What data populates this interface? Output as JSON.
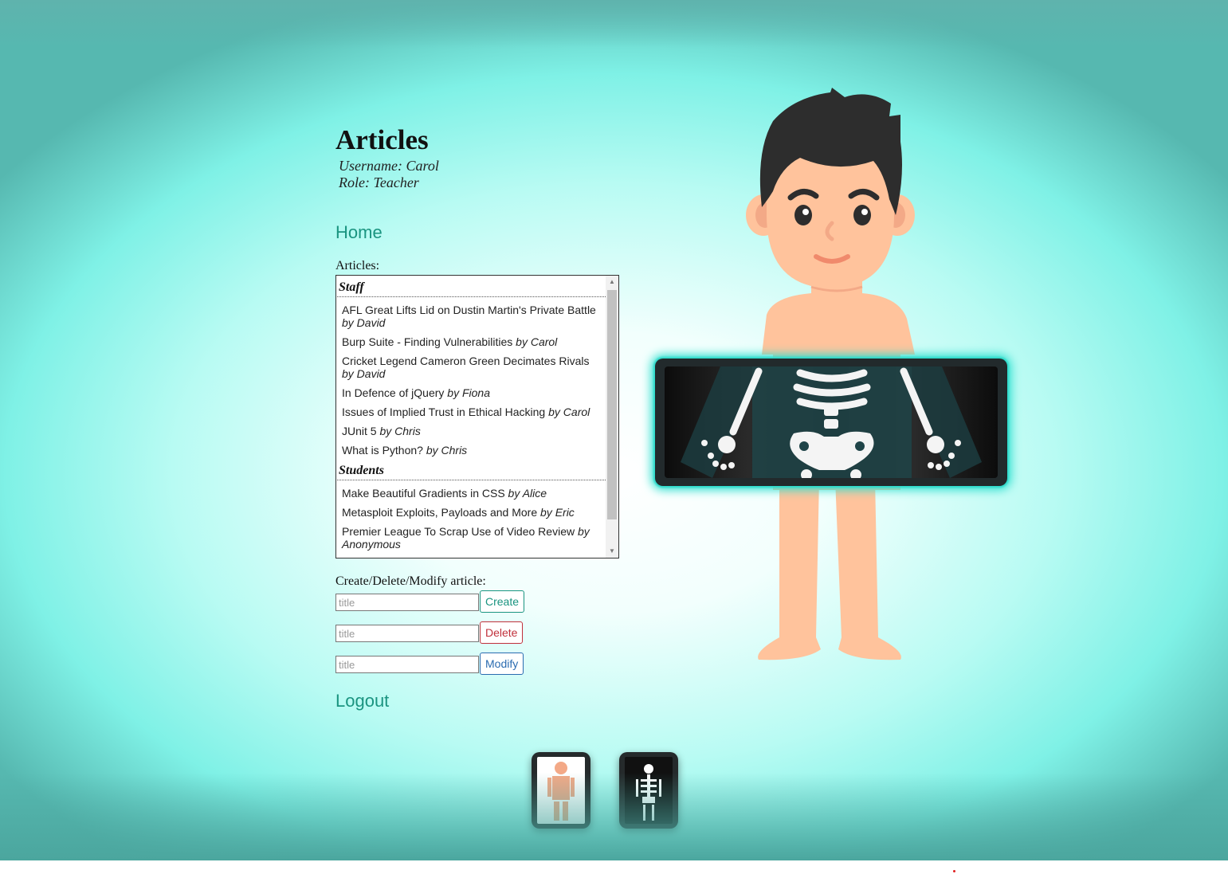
{
  "header": {
    "title": "Articles",
    "username": "Username: Carol",
    "role": "Role: Teacher"
  },
  "nav": {
    "home": "Home",
    "logout": "Logout"
  },
  "articles": {
    "label": "Articles:",
    "groups": [
      {
        "name": "Staff",
        "items": [
          {
            "title": "AFL Great Lifts Lid on Dustin Martin's Private Battle",
            "author": "by David"
          },
          {
            "title": "Burp Suite - Finding Vulnerabilities",
            "author": "by Carol"
          },
          {
            "title": "Cricket Legend Cameron Green Decimates Rivals",
            "author": "by David"
          },
          {
            "title": "In Defence of jQuery",
            "author": "by Fiona"
          },
          {
            "title": "Issues of Implied Trust in Ethical Hacking",
            "author": "by Carol"
          },
          {
            "title": "JUnit 5",
            "author": "by Chris"
          },
          {
            "title": "What is Python?",
            "author": "by Chris"
          }
        ]
      },
      {
        "name": "Students",
        "items": [
          {
            "title": "Make Beautiful Gradients in CSS",
            "author": "by Alice"
          },
          {
            "title": "Metasploit Exploits, Payloads and More",
            "author": "by Eric"
          },
          {
            "title": "Premier League To Scrap Use of Video Review",
            "author": "by Anonymous"
          }
        ]
      }
    ]
  },
  "manage": {
    "label": "Create/Delete/Modify article:",
    "placeholder": "title",
    "create": "Create",
    "delete": "Delete",
    "modify": "Modify"
  },
  "colors": {
    "accent": "#1a9480",
    "delete": "#c0303b",
    "modify": "#2a6bb0",
    "skin": "#ffc39c",
    "hair": "#2d2d2d",
    "glow": "#2fe0d0"
  },
  "icons": {
    "view_normal": "body-icon",
    "view_xray": "skeleton-icon"
  }
}
